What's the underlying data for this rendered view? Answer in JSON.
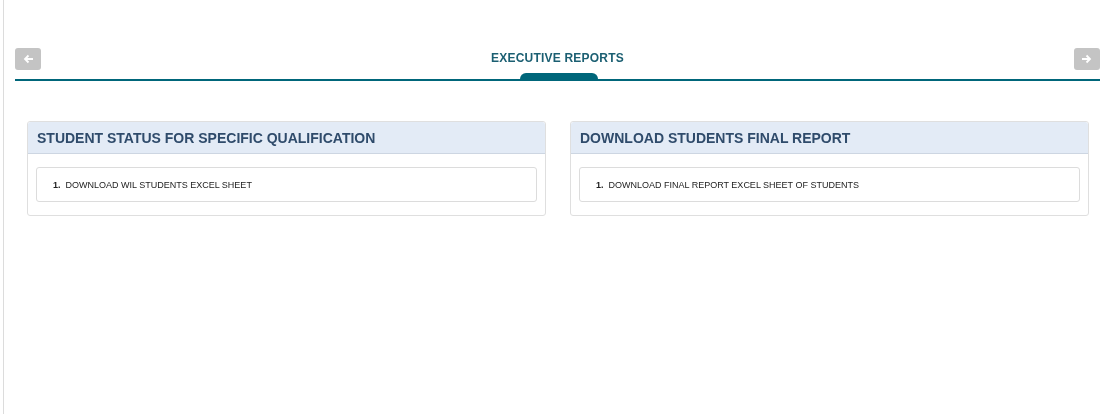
{
  "page_title": "EXECUTIVE REPORTS",
  "panels": [
    {
      "title": "STUDENT STATUS FOR SPECIFIC QUALIFICATION",
      "items": [
        {
          "number": "1.",
          "label": "DOWNLOAD WIL STUDENTS EXCEL SHEET"
        }
      ]
    },
    {
      "title": "DOWNLOAD STUDENTS FINAL REPORT",
      "items": [
        {
          "number": "1.",
          "label": "DOWNLOAD FINAL REPORT EXCEL SHEET OF STUDENTS"
        }
      ]
    }
  ]
}
